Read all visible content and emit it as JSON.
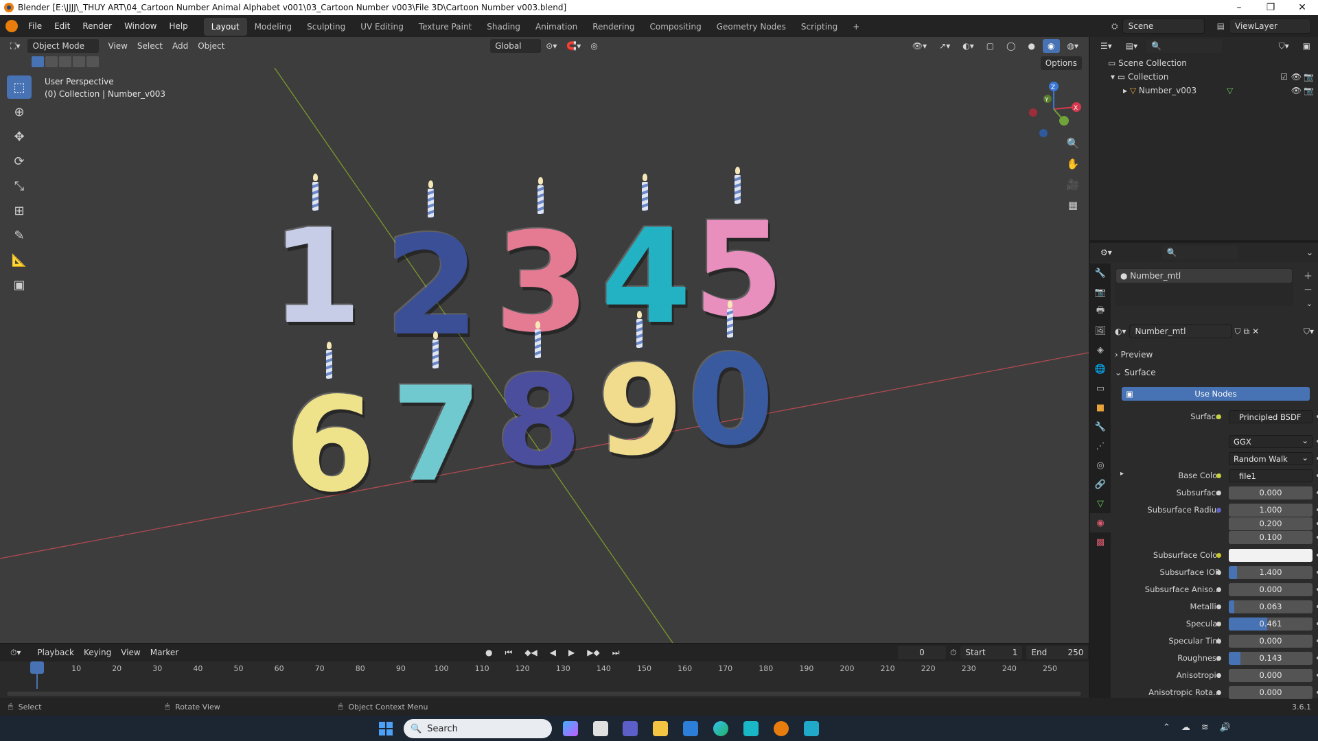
{
  "window": {
    "title": "Blender [E:\\JJJJ\\_THUY ART\\04_Cartoon Number Animal Alphabet v001\\03_Cartoon Number v003\\File 3D\\Cartoon Number v003.blend]",
    "minimize": "–",
    "maximize": "❐",
    "close": "✕"
  },
  "menu": [
    "File",
    "Edit",
    "Render",
    "Window",
    "Help"
  ],
  "workspaces": [
    "Layout",
    "Modeling",
    "Sculpting",
    "UV Editing",
    "Texture Paint",
    "Shading",
    "Animation",
    "Rendering",
    "Compositing",
    "Geometry Nodes",
    "Scripting",
    "+"
  ],
  "active_workspace": "Layout",
  "scene_name": "Scene",
  "view_layer": "ViewLayer",
  "viewport": {
    "mode": "Object Mode",
    "menus": [
      "View",
      "Select",
      "Add",
      "Object"
    ],
    "orientation": "Global",
    "options": "Options",
    "overlay_line1": "User Perspective",
    "overlay_line2": "(0) Collection | Number_v003",
    "gizmo": {
      "x": "X",
      "y": "Y",
      "z": "Z"
    }
  },
  "numbers_top": [
    "1",
    "2",
    "3",
    "4",
    "5"
  ],
  "numbers_bottom": [
    "6",
    "7",
    "8",
    "9",
    "0"
  ],
  "colors": {
    "accent": "#4772b3",
    "one": "#c7cde6",
    "two": "#3a4f96",
    "three": "#e57b93",
    "four": "#23b2c3",
    "five": "#e98fbe",
    "six": "#eee28a",
    "seven": "#6fc9cf",
    "eight": "#4b4e9c",
    "nine": "#f0dc8c",
    "zero": "#3a5aa0"
  },
  "timeline": {
    "menus": [
      "Playback",
      "Keying",
      "View",
      "Marker"
    ],
    "current_frame": "0",
    "start_label": "Start",
    "start": "1",
    "end_label": "End",
    "end": "250",
    "ticks": [
      "0",
      "10",
      "20",
      "30",
      "40",
      "50",
      "60",
      "70",
      "80",
      "90",
      "100",
      "110",
      "120",
      "130",
      "140",
      "150",
      "160",
      "170",
      "180",
      "190",
      "200",
      "210",
      "220",
      "230",
      "240",
      "250"
    ]
  },
  "status": {
    "select": "Select",
    "rotate": "Rotate View",
    "context": "Object Context Menu",
    "version": "3.6.1"
  },
  "outliner": {
    "scene_collection": "Scene Collection",
    "collection": "Collection",
    "object": "Number_v003"
  },
  "properties": {
    "slot_material": "Number_mtl",
    "material_name": "Number_mtl",
    "preview": "Preview",
    "surface_panel": "Surface",
    "use_nodes": "Use Nodes",
    "rows": [
      {
        "label": "Surface",
        "value": "Principled BSDF",
        "kind": "link"
      },
      {
        "label": "",
        "value": "GGX",
        "kind": "dropdown"
      },
      {
        "label": "",
        "value": "Random Walk",
        "kind": "dropdown"
      },
      {
        "label": "Base Color",
        "value": "file1",
        "kind": "link"
      },
      {
        "label": "Subsurface",
        "value": "0.000",
        "kind": "num",
        "fill": 0
      },
      {
        "label": "Subsurface Radius",
        "value": "1.000",
        "kind": "num",
        "fill": 0
      },
      {
        "label": "",
        "value": "0.200",
        "kind": "num",
        "fill": 0
      },
      {
        "label": "",
        "value": "0.100",
        "kind": "num",
        "fill": 0
      },
      {
        "label": "Subsurface Color",
        "value": "",
        "kind": "color"
      },
      {
        "label": "Subsurface IOR",
        "value": "1.400",
        "kind": "num",
        "fill": 0.1
      },
      {
        "label": "Subsurface Aniso...",
        "value": "0.000",
        "kind": "num",
        "fill": 0
      },
      {
        "label": "Metallic",
        "value": "0.063",
        "kind": "num",
        "fill": 0.063
      },
      {
        "label": "Specular",
        "value": "0.461",
        "kind": "num",
        "fill": 0.461
      },
      {
        "label": "Specular Tint",
        "value": "0.000",
        "kind": "num",
        "fill": 0
      },
      {
        "label": "Roughness",
        "value": "0.143",
        "kind": "num",
        "fill": 0.143
      },
      {
        "label": "Anisotropic",
        "value": "0.000",
        "kind": "num",
        "fill": 0
      },
      {
        "label": "Anisotropic Rota...",
        "value": "0.000",
        "kind": "num",
        "fill": 0
      }
    ]
  },
  "taskbar": {
    "search": "Search"
  }
}
